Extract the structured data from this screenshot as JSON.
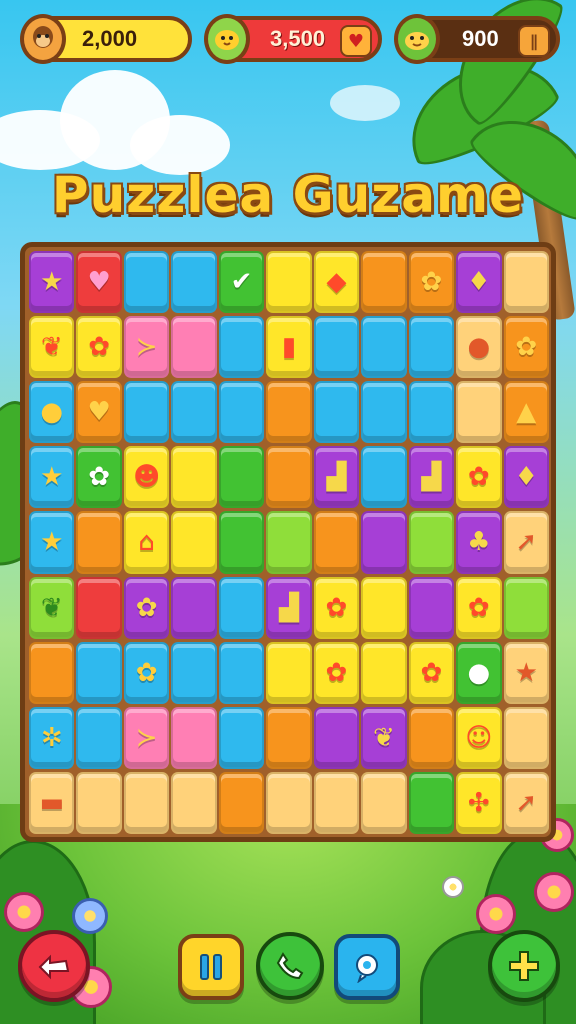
{
  "title": "Puzzlea Guzame",
  "hud": {
    "coins": "2,000",
    "gems": "3,500",
    "lives": "900"
  },
  "colors": {
    "purple": "#a63fd6",
    "red": "#ee3d3d",
    "blue": "#2fb9ee",
    "green": "#42c233",
    "yellow": "#ffe629",
    "orange": "#f7941d",
    "peach": "#ffd27a",
    "pink": "#ff7fb4",
    "lime": "#8fde3a"
  },
  "board": {
    "rows": 9,
    "cols": 11,
    "tiles": [
      [
        "purple:star-icon",
        "red:heart-icon",
        "blue",
        "blue",
        "green:check-icon",
        "yellow",
        "yellow:diamond-icon",
        "orange",
        "orange:flower-icon",
        "purple:gem-icon",
        "peach"
      ],
      [
        "yellow:leaf-icon",
        "yellow:flower-icon",
        "pink:fish-icon",
        "pink",
        "blue",
        "yellow:battery-icon",
        "blue",
        "blue",
        "blue",
        "peach:balloon-icon",
        "orange:flower-icon"
      ],
      [
        "blue:apple-icon",
        "orange:heart-icon",
        "blue",
        "blue",
        "blue",
        "orange",
        "blue",
        "blue",
        "blue",
        "peach",
        "orange:triangle-icon"
      ],
      [
        "blue:star-icon",
        "green:flower-icon",
        "yellow:chick-icon",
        "yellow",
        "green",
        "orange",
        "purple:stairs-icon",
        "blue",
        "purple:stairs-icon",
        "yellow:flower-icon",
        "purple:gem-icon"
      ],
      [
        "blue:star-icon",
        "orange",
        "yellow:house-icon",
        "yellow",
        "green",
        "lime",
        "orange",
        "purple",
        "lime",
        "purple:tree-icon",
        "peach:arrow-icon"
      ],
      [
        "lime:leaf-icon",
        "red",
        "purple:flower-icon",
        "purple",
        "blue",
        "purple:stairs-icon",
        "yellow:flower-icon",
        "yellow",
        "purple",
        "yellow:flower-icon",
        "lime"
      ],
      [
        "orange",
        "blue",
        "blue:flower-icon",
        "blue",
        "blue",
        "yellow",
        "yellow:flower-icon",
        "yellow",
        "yellow:flower-icon",
        "green:apple-icon",
        "peach:star-icon"
      ],
      [
        "blue:bee-icon",
        "blue",
        "pink:fish-icon",
        "pink",
        "blue",
        "orange",
        "purple",
        "purple:leaf-icon",
        "orange",
        "yellow:smile-icon",
        "peach"
      ],
      [
        "peach:bench-icon",
        "peach",
        "peach",
        "peach",
        "orange",
        "peach",
        "peach",
        "peach",
        "green",
        "yellow:bug-icon",
        "peach:arrow-icon"
      ]
    ]
  },
  "buttons": {
    "back": "back-icon",
    "pause": "pause-icon",
    "call": "phone-icon",
    "hint": "hint-icon",
    "add": "plus-icon"
  }
}
